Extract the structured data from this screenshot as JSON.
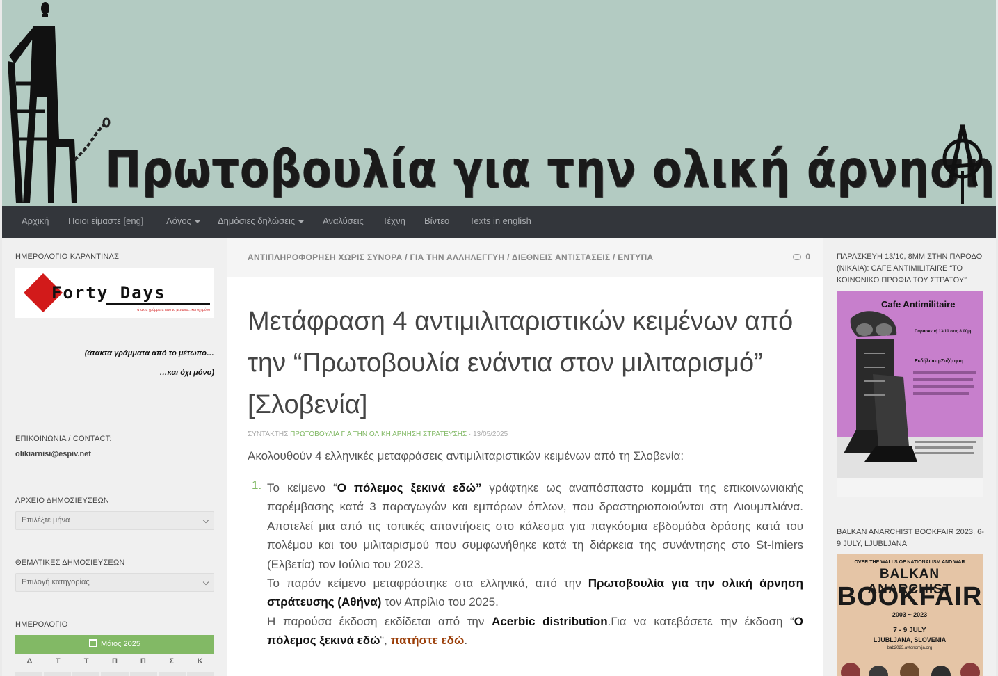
{
  "header": {
    "banner_title": "Πρωτοβουλία για την ολική άρνηση στράτευσης"
  },
  "nav": {
    "items": [
      {
        "label": "Αρχική"
      },
      {
        "label": "Ποιοι είμαστε [eng]"
      },
      {
        "label": "Λόγος"
      },
      {
        "label": "Δημόσιες δηλώσεις"
      },
      {
        "label": "Αναλύσεις"
      },
      {
        "label": "Τέχνη"
      },
      {
        "label": "Βίντεο"
      },
      {
        "label": "Texts in english"
      }
    ]
  },
  "sidebar_left": {
    "quarantine_title": "ΗΜΕΡΟΛΟΓΙΟ ΚΑΡΑΝΤΙΝΑΣ",
    "forty_days_logo": "Forty Days",
    "forty_days_tagline": "άτακτα γράμματα από το μέτωπο…και όχι μόνο",
    "quote_line1": "(άτακτα γράμματα από το μέτωπο…",
    "quote_line2": "…και όχι μόνο)",
    "contact_title": "ΕΠΙΚΟΙΝΩΝΙΑ / CONTACT:",
    "contact_email": "olikiarnisi@espiv.net",
    "archive_title": "ΑΡΧΕΙΟ ΔΗΜΟΣΙΕΥΣΕΩΝ",
    "archive_select": "Επιλέξτε μήνα",
    "categories_title": "ΘΕΜΑΤΙΚΕΣ ΔΗΜΟΣΙΕΥΣΕΩΝ",
    "categories_select": "Επιλογή κατηγορίας",
    "calendar_title": "ΗΜΕΡΟΛΟΓΙΟ",
    "calendar_month": "Μάιος 2025",
    "calendar_days": [
      "Δ",
      "Τ",
      "Τ",
      "Π",
      "Π",
      "Σ",
      "Κ"
    ]
  },
  "post": {
    "categories": [
      "ΑΝΤΙΠΛΗΡΟΦΟΡΗΣΗ ΧΩΡΙΣ ΣΥΝΟΡΑ",
      "ΓΙΑ ΤΗΝ ΑΛΛΗΛΕΓΓΥΗ",
      "ΔΙΕΘΝΕΙΣ ΑΝΤΙΣΤΑΣΕΙΣ",
      "ΕΝΤΥΠΑ"
    ],
    "categories_text": "ΑΝΤΙΠΛΗΡΟΦΟΡΗΣΗ ΧΩΡΙΣ ΣΥΝΟΡΑ / ΓΙΑ ΤΗΝ ΑΛΛΗΛΕΓΓΥΗ / ΔΙΕΘΝΕΙΣ ΑΝΤΙΣΤΑΣΕΙΣ / ΕΝΤΥΠΑ",
    "comment_count": "0",
    "title": "Μετάφραση 4 αντιμιλιταριστικών κειμένων από την “Πρωτοβουλία ενάντια στον μιλιταρισμό” [Σλοβενία]",
    "byline_prefix": "ΣΥΝΤΑΚΤΗΣ",
    "author": "ΠΡΩΤΟΒΟΥΛΙΑ ΓΙΑ ΤΗΝ ΟΛΙΚΗ ΑΡΝΗΣΗ ΣΤΡΑΤΕΥΣΗΣ",
    "date": "· 13/05/2025",
    "lead": "Ακολουθούν 4 ελληνικές μεταφράσεις αντιμιλιταριστικών κειμένων από τη Σλοβενία:",
    "item_number": "1.",
    "p1_a": "Το κείμενο “",
    "p1_b": "Ο πόλεμος ξεκινά εδώ”",
    "p1_c": " γράφτηκε ως αναπόσπαστο κομμάτι της επικοινωνιακής παρέμβασης κατά 3 παραγωγών και εμπόρων όπλων, που δραστηριοποιούνται στη Λιουμπλιάνα. Αποτελεί μια από τις τοπικές απαντήσεις στο κάλεσμα για παγκόσμια εβδομάδα δράσης κατά του πολέμου και του μιλιταρισμού που συμφωνήθηκε κατά τη διάρκεια της συνάντησης στο St-Imiers (Ελβετία) τον Ιούλιο του 2023.",
    "p2_a": "Το παρόν κείμενο μεταφράστηκε στα ελληνικά, από την ",
    "p2_b": "Πρωτοβουλία για την ολική άρνηση στράτευσης (Αθήνα)",
    "p2_c": " τον Απρίλιο του 2025.",
    "p3_a": "Η παρούσα έκδοση εκδίδεται από την ",
    "p3_b": "Acerbic distribution",
    "p3_c": ".Για να κατεβάσετε την έκδοση “",
    "p3_d": "Ο πόλεμος ξεκινά εδώ",
    "p3_e": "“, ",
    "p3_link": "πατήστε εδώ",
    "p3_f": "."
  },
  "sidebar_right": {
    "event1_title": "ΠΑΡΑΣΚΕΥΗ 13/10, 8ΜΜ ΣΤΗΝ ΠΑΡΟΔΟ (ΝΙΚΑΙΑ): CAFE ANTIMILITAIRE “ΤΟ ΚΟΙΝΩΝΙΚΟ ΠΡΟΦΙΛ ΤΟΥ ΣΤΡΑΤΟΥ”",
    "poster1_heading": "Cafe Antimilitaire",
    "poster1_date": "Παρασκευή 13/10 στις 8.00μμ",
    "poster1_event": "Εκδήλωση-Συζήτηση",
    "event2_title": "BALKAN ANARCHIST BOOKFAIR 2023, 6-9 JULY, LJUBLJANA",
    "poster2_top": "OVER THE WALLS OF NATIONALISM AND WAR",
    "poster2_line1": "BALKAN ANARCHIST",
    "poster2_line2": "BOOKFAIR",
    "poster2_years": "2003 ~ 2023",
    "poster2_dates": "7 - 9 JULY",
    "poster2_place": "LJUBLJANA, SLOVENIA",
    "poster2_url": "bab2023.avtonomija.org"
  }
}
